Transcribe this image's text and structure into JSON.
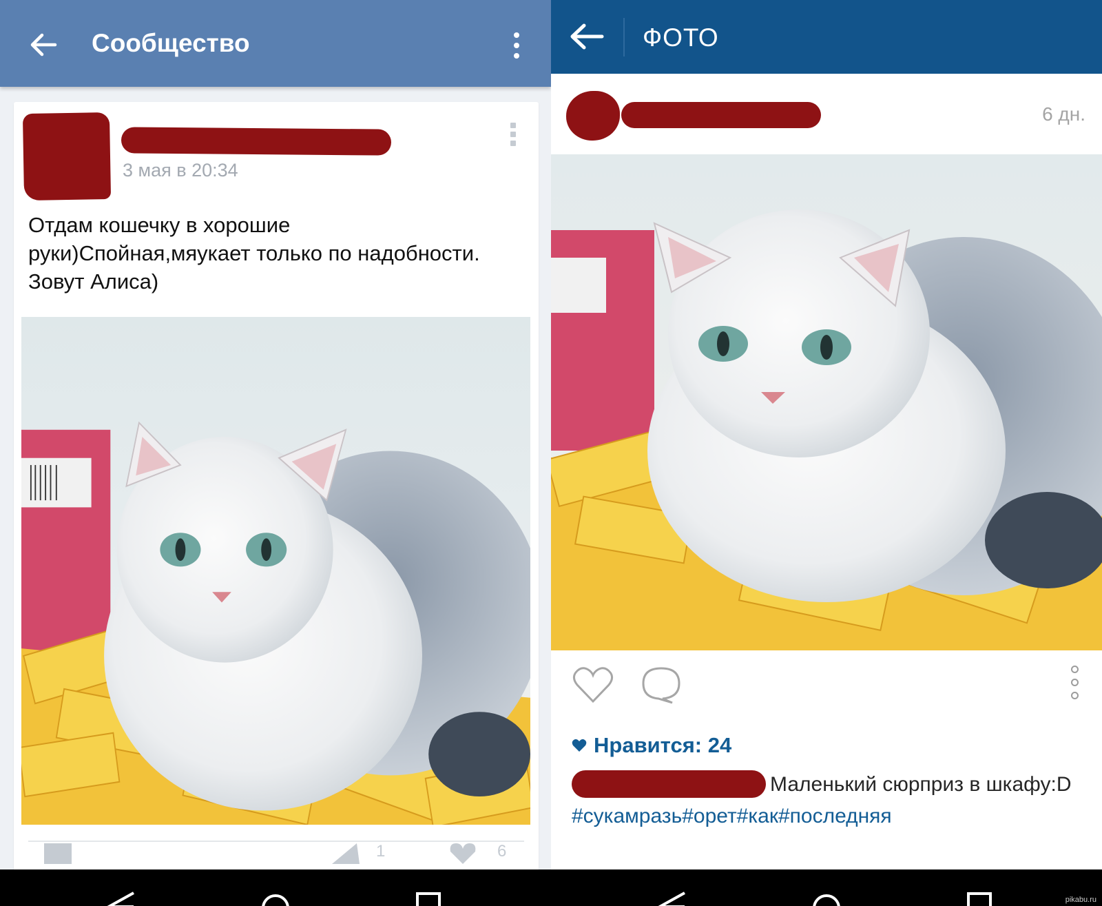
{
  "left": {
    "header": {
      "title": "Сообщество",
      "back_icon": "arrow-left-icon",
      "menu_icon": "more-vertical-icon"
    },
    "post": {
      "date": "3 мая в 20:34",
      "text": "Отдам кошечку в хорошие руки)Спойная,мяукает только по надобности. Зовут Алиса)",
      "footer_counts": {
        "shares": "1",
        "likes": "6"
      }
    }
  },
  "right": {
    "header": {
      "title": "ФОТО",
      "back_icon": "arrow-left-icon"
    },
    "post": {
      "time": "6 дн.",
      "likes_text": "Нравится: 24",
      "caption_text": "Маленький сюрприз в шкафу:D ",
      "caption_tags": "#сукамразь#орет#как#последняя"
    }
  },
  "watermark": "pikabu.ru",
  "colors": {
    "vk_header": "#5a80b1",
    "ig_header": "#12548b",
    "redaction": "#8e1214",
    "ig_link": "#135d95"
  }
}
